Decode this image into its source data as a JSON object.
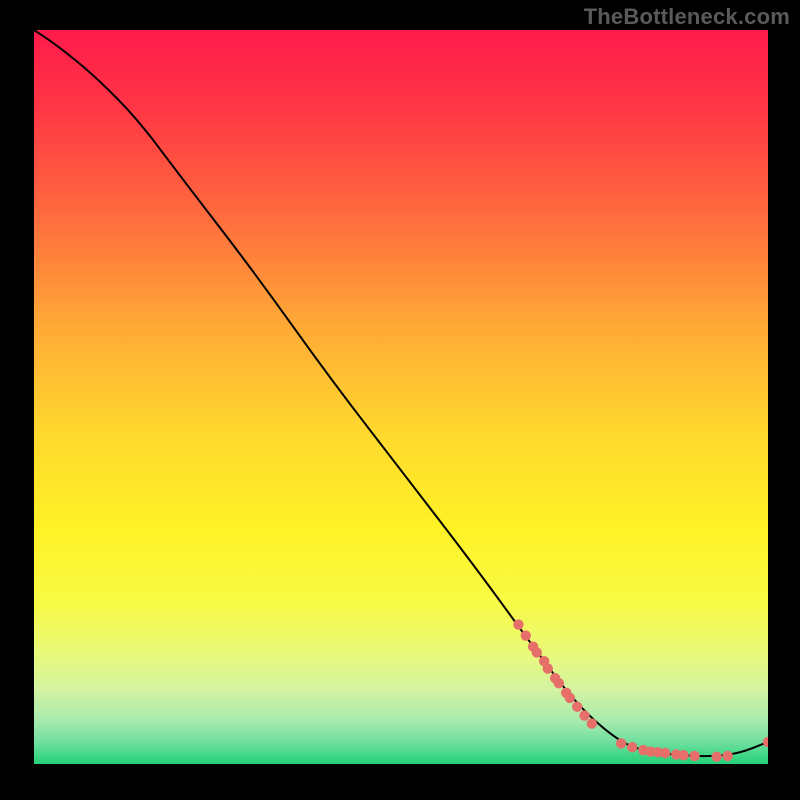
{
  "attribution": "TheBottleneck.com",
  "chart_data": {
    "type": "line",
    "title": "",
    "xlabel": "",
    "ylabel": "",
    "xlim": [
      0,
      100
    ],
    "ylim": [
      0,
      100
    ],
    "gradient_stops": [
      {
        "offset": 0.0,
        "color": "#ff1b4b"
      },
      {
        "offset": 0.1,
        "color": "#ff3445"
      },
      {
        "offset": 0.25,
        "color": "#ff6a3e"
      },
      {
        "offset": 0.4,
        "color": "#ffa836"
      },
      {
        "offset": 0.55,
        "color": "#ffd92e"
      },
      {
        "offset": 0.68,
        "color": "#fff226"
      },
      {
        "offset": 0.78,
        "color": "#f8fb45"
      },
      {
        "offset": 0.85,
        "color": "#e9f97a"
      },
      {
        "offset": 0.9,
        "color": "#d2f3a2"
      },
      {
        "offset": 0.94,
        "color": "#a9ebad"
      },
      {
        "offset": 0.97,
        "color": "#6fdf9f"
      },
      {
        "offset": 1.0,
        "color": "#23d177"
      }
    ],
    "curve": [
      {
        "x": 0,
        "y": 100
      },
      {
        "x": 3,
        "y": 98
      },
      {
        "x": 8,
        "y": 94
      },
      {
        "x": 14,
        "y": 88
      },
      {
        "x": 20,
        "y": 80
      },
      {
        "x": 30,
        "y": 67
      },
      {
        "x": 40,
        "y": 53
      },
      {
        "x": 50,
        "y": 40
      },
      {
        "x": 60,
        "y": 27
      },
      {
        "x": 68,
        "y": 16
      },
      {
        "x": 74,
        "y": 8
      },
      {
        "x": 80,
        "y": 2.8
      },
      {
        "x": 84,
        "y": 1.6
      },
      {
        "x": 88,
        "y": 1.2
      },
      {
        "x": 92,
        "y": 1.0
      },
      {
        "x": 96,
        "y": 1.4
      },
      {
        "x": 100,
        "y": 3
      }
    ],
    "scatter_points": [
      {
        "x": 66,
        "y": 19
      },
      {
        "x": 67,
        "y": 17.5
      },
      {
        "x": 68,
        "y": 16
      },
      {
        "x": 68.5,
        "y": 15.2
      },
      {
        "x": 69.5,
        "y": 14
      },
      {
        "x": 70,
        "y": 13
      },
      {
        "x": 71,
        "y": 11.7
      },
      {
        "x": 71.5,
        "y": 11
      },
      {
        "x": 72.5,
        "y": 9.7
      },
      {
        "x": 73,
        "y": 9
      },
      {
        "x": 74,
        "y": 7.8
      },
      {
        "x": 75,
        "y": 6.6
      },
      {
        "x": 76,
        "y": 5.5
      },
      {
        "x": 80,
        "y": 2.8
      },
      {
        "x": 81.5,
        "y": 2.3
      },
      {
        "x": 83,
        "y": 1.9
      },
      {
        "x": 84,
        "y": 1.7
      },
      {
        "x": 85,
        "y": 1.6
      },
      {
        "x": 86,
        "y": 1.5
      },
      {
        "x": 87.5,
        "y": 1.3
      },
      {
        "x": 88.5,
        "y": 1.2
      },
      {
        "x": 90,
        "y": 1.1
      },
      {
        "x": 93,
        "y": 1.0
      },
      {
        "x": 94.5,
        "y": 1.1
      },
      {
        "x": 100,
        "y": 3
      }
    ],
    "dot_radius": 5.2
  }
}
